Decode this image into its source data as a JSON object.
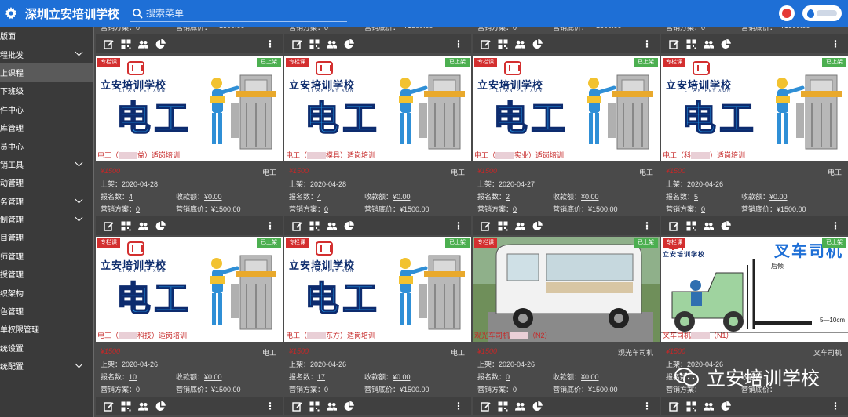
{
  "header": {
    "title": "深圳立安培训学校",
    "search_placeholder": "搜索菜单"
  },
  "sidebar": {
    "items": [
      {
        "label": "版面",
        "chevron": false
      },
      {
        "label": "程批发",
        "chevron": true
      },
      {
        "label": "上课程",
        "chevron": false,
        "active": true
      },
      {
        "label": "下班级",
        "chevron": false
      },
      {
        "label": "件中心",
        "chevron": false
      },
      {
        "label": "库管理",
        "chevron": false
      },
      {
        "label": "员中心",
        "chevron": false
      },
      {
        "label": "销工具",
        "chevron": true
      },
      {
        "label": "动管理",
        "chevron": false
      },
      {
        "label": "务管理",
        "chevron": true
      },
      {
        "label": "制管理",
        "chevron": true
      },
      {
        "label": "目管理",
        "chevron": false
      },
      {
        "label": "师管理",
        "chevron": false
      },
      {
        "label": "授管理",
        "chevron": false
      },
      {
        "label": "织架构",
        "chevron": false
      },
      {
        "label": "色管理",
        "chevron": false
      },
      {
        "label": "单权限管理",
        "chevron": false
      },
      {
        "label": "统设置",
        "chevron": false
      },
      {
        "label": "统配置",
        "chevron": true
      }
    ]
  },
  "labels": {
    "tag_special": "专栏课",
    "tag_listed": "已上架",
    "listed_prefix": "上架：",
    "enroll_label": "报名数：",
    "revenue_label": "收款额：",
    "marketing_label": "营销方案：",
    "base_price_label": "营销底价：",
    "school_name": "立安培训学校",
    "school_pinyin": "LI AN PEI XUN",
    "big_word": "电工",
    "watermark": "立安培训学校"
  },
  "top_partial": [
    {
      "marketing": "0",
      "base_price": "¥1500.00"
    },
    {
      "marketing": "0",
      "base_price": "¥1500.00"
    },
    {
      "marketing": "0",
      "base_price": "¥1500.00"
    },
    {
      "marketing": "0",
      "base_price": "¥1500.00"
    }
  ],
  "rows": [
    [
      {
        "caption_a": "电工（",
        "caption_b": "益）适岗培训",
        "price": "¥1500",
        "category": "电工",
        "date": "2020-04-28",
        "enroll": "4",
        "revenue": "¥0.00",
        "marketing": "0",
        "base_price": "¥1500.00",
        "art": "electric"
      },
      {
        "caption_a": "电工（",
        "caption_b": "模具）适岗培训",
        "price": "¥1500",
        "category": "电工",
        "date": "2020-04-28",
        "enroll": "4",
        "revenue": "¥0.00",
        "marketing": "0",
        "base_price": "¥1500.00",
        "art": "electric"
      },
      {
        "caption_a": "电工（",
        "caption_b": "实业）适岗培训",
        "price": "¥1500",
        "category": "电工",
        "date": "2020-04-27",
        "enroll": "2",
        "revenue": "¥0.00",
        "marketing": "0",
        "base_price": "¥1500.00",
        "art": "electric"
      },
      {
        "caption_a": "电工（科",
        "caption_b": "）适岗培训",
        "price": "¥1500",
        "category": "电工",
        "date": "2020-04-26",
        "enroll": "5",
        "revenue": "¥0.00",
        "marketing": "0",
        "base_price": "¥1500.00",
        "art": "electric"
      }
    ],
    [
      {
        "caption_a": "电工（",
        "caption_b": "科技）适岗培训",
        "price": "¥1500",
        "category": "电工",
        "date": "2020-04-26",
        "enroll": "10",
        "revenue": "¥0.00",
        "marketing": "0",
        "base_price": "¥1500.00",
        "art": "electric"
      },
      {
        "caption_a": "电工（",
        "caption_b": "东方）适岗培训",
        "price": "¥1500",
        "category": "电工",
        "date": "2020-04-26",
        "enroll": "17",
        "revenue": "¥0.00",
        "marketing": "0",
        "base_price": "¥1500.00",
        "art": "electric"
      },
      {
        "caption_a": "观光车司机",
        "caption_b": "（N2）",
        "price": "¥1500",
        "category": "观光车司机",
        "date": "2020-04-26",
        "enroll": "0",
        "revenue": "¥0.00",
        "marketing": "0",
        "base_price": "¥1500.00",
        "art": "cart"
      },
      {
        "caption_a": "叉车司机",
        "caption_b": "（N1）",
        "price": "¥1500",
        "category": "叉车司机",
        "date": "2020-04-26",
        "enroll": "",
        "revenue": "",
        "marketing": "",
        "base_price": "",
        "art": "forklift",
        "art_title": "叉车司机",
        "art_note1": "后倾",
        "art_note2": "5—10cm"
      }
    ]
  ],
  "colors": {
    "accent": "#1e6fd6",
    "tag_red": "#d32f2f",
    "tag_green": "#4caf50",
    "bg": "#4a4a4a"
  },
  "icons": [
    "edit-icon",
    "qrcode-icon",
    "users-icon",
    "pie-chart-icon",
    "more-icon",
    "search-icon",
    "gear-icon"
  ]
}
